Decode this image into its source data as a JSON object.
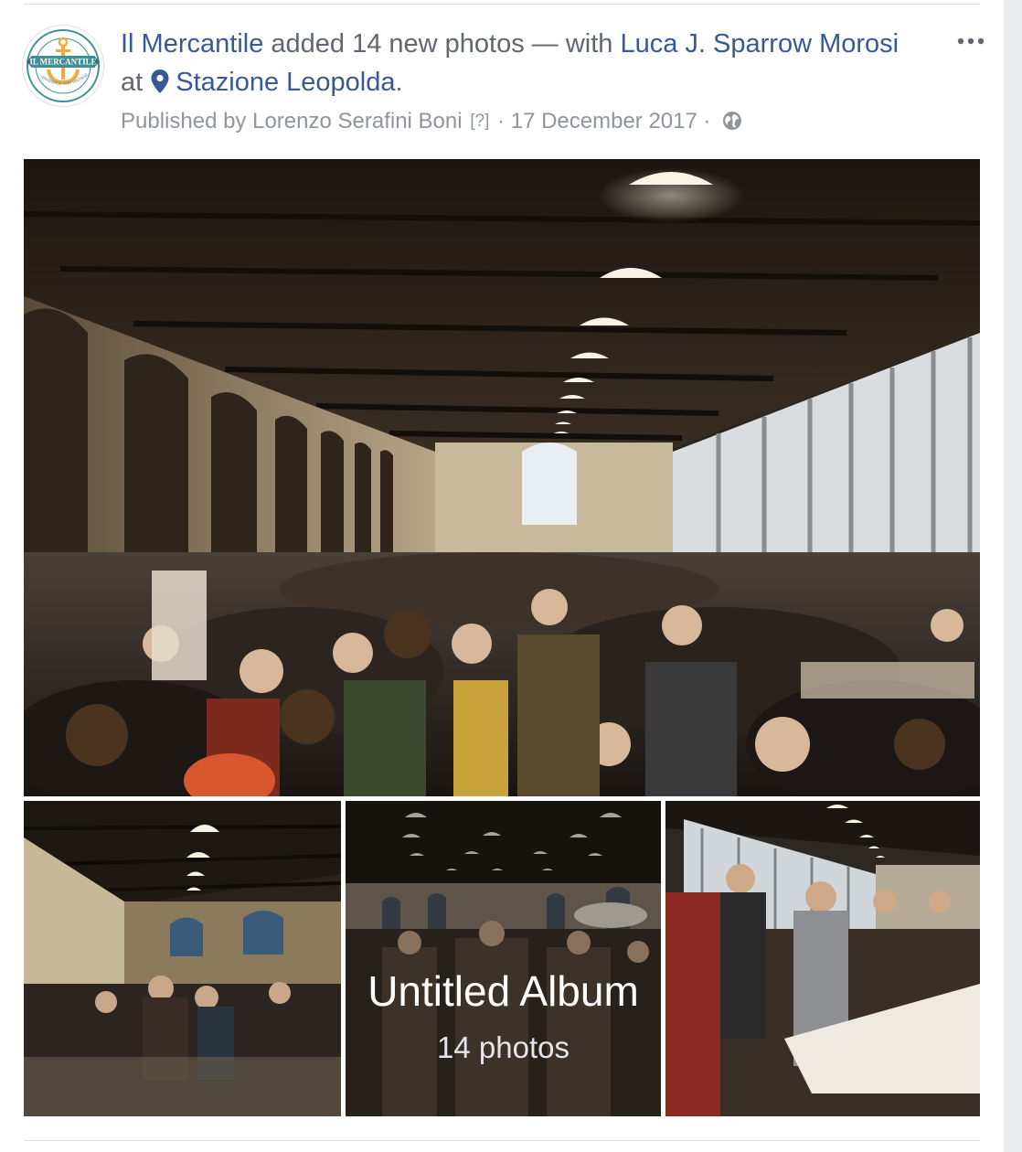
{
  "post": {
    "page_name": "Il Mercantile",
    "action_text": "added 14 new photos — with",
    "tagged_person": "Luca J. Sparrow Morosi",
    "at_text": "at",
    "location": "Stazione Leopolda",
    "location_icon": "location-pin-icon",
    "published_by": "Published by Lorenzo Serafini Boni",
    "help_marker": "[?]",
    "separator": "·",
    "date": "17 December 2017",
    "audience_icon": "globe-icon",
    "more_icon": "more-options-icon"
  },
  "avatar": {
    "logo_text": "IL MERCANTILE",
    "logo_subtext": "HANDMADE AND VINTAGE MARKET"
  },
  "album": {
    "title": "Untitled Album",
    "count_label": "14 photos"
  },
  "colors": {
    "link": "#385898",
    "text": "#616770",
    "meta": "#90949c",
    "logo_teal": "#3f8f96",
    "logo_orange": "#f2a93b"
  }
}
